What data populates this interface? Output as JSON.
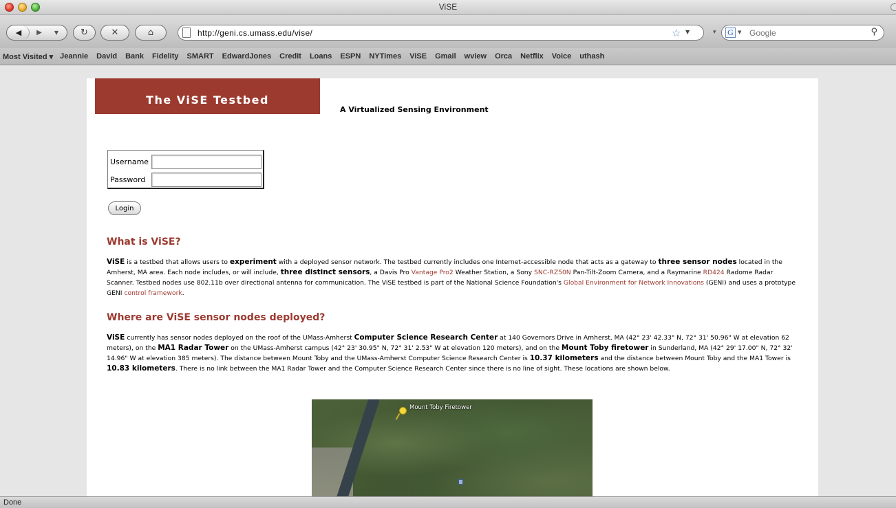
{
  "window": {
    "title": "ViSE"
  },
  "toolbar": {
    "url": "http://geni.cs.umass.edu/vise/",
    "search_placeholder": "Google"
  },
  "bookmarks": {
    "most_visited": "Most Visited ▾",
    "items": [
      "Jeannie",
      "David",
      "Bank",
      "Fidelity",
      "SMART",
      "EdwardJones",
      "Credit",
      "Loans",
      "ESPN",
      "NYTimes",
      "ViSE",
      "Gmail",
      "wview",
      "Orca",
      "Netflix",
      "Voice",
      "uthash"
    ]
  },
  "page": {
    "banner": "The ViSE Testbed",
    "tagline": "A Virtualized Sensing Environment",
    "login": {
      "username_label": "Username",
      "password_label": "Password",
      "login_button": "Login"
    },
    "section1": {
      "heading": "What is ViSE?",
      "t01": "ViSE",
      "t02": " is a testbed that allows users to ",
      "t03": "experiment",
      "t04": " with a deployed sensor network. The testbed currently includes one Internet-accessible node that acts as a gateway to ",
      "t05": "three sensor nodes",
      "t06": " located in the Amherst, MA area. Each node includes, or will include, ",
      "t07": "three distinct sensors",
      "t08": ", a Davis Pro ",
      "t09": "Vantage Pro2",
      "t10": " Weather Station, a Sony ",
      "t11": "SNC-RZ50N",
      "t12": " Pan-Tilt-Zoom Camera, and a Raymarine ",
      "t13": "RD424",
      "t14": " Radome Radar Scanner. Testbed nodes use 802.11b over directional antenna for communication. The ViSE testbed is part of the National Science Foundation's ",
      "t15": "Global Environment for Network Innovations",
      "t16": " (GENI) and uses a prototype GENI ",
      "t17": "control framework",
      "t18": "."
    },
    "section2": {
      "heading": "Where are ViSE sensor nodes deployed?",
      "t01": "ViSE",
      "t02": " currently has sensor nodes deployed on the roof of the UMass-Amherst ",
      "t03": "Computer Science Research Center",
      "t04": " at 140 Governors Drive in Amherst, MA (42° 23' 42.33\" N, 72° 31' 50.96\" W at elevation 62 meters), on the ",
      "t05": "MA1 Radar Tower",
      "t06": " on the UMass-Amherst campus (42° 23' 30.95\" N, 72° 31' 2.53\" W at elevation 120 meters), and on the ",
      "t07": "Mount Toby firetower",
      "t08": " in Sunderland, MA (42° 29' 17.00\" N, 72° 32' 14.96\" W at elevation 385 meters). The distance between Mount Toby and the UMass-Amherst Computer Science Research Center is ",
      "t09": "10.37 kilometers",
      "t10": " and the distance between Mount Toby and the MA1 Tower is ",
      "t11": "10.83 kilometers",
      "t12": ". There is no link between the MA1 Radar Tower and the Computer Science Research Center since there is no line of sight. These locations are shown below."
    },
    "map": {
      "label": "Mount Toby Firetower"
    }
  },
  "status": {
    "text": "Done"
  },
  "colors": {
    "brand": "#9c3a30",
    "link": "#9c3a30"
  }
}
